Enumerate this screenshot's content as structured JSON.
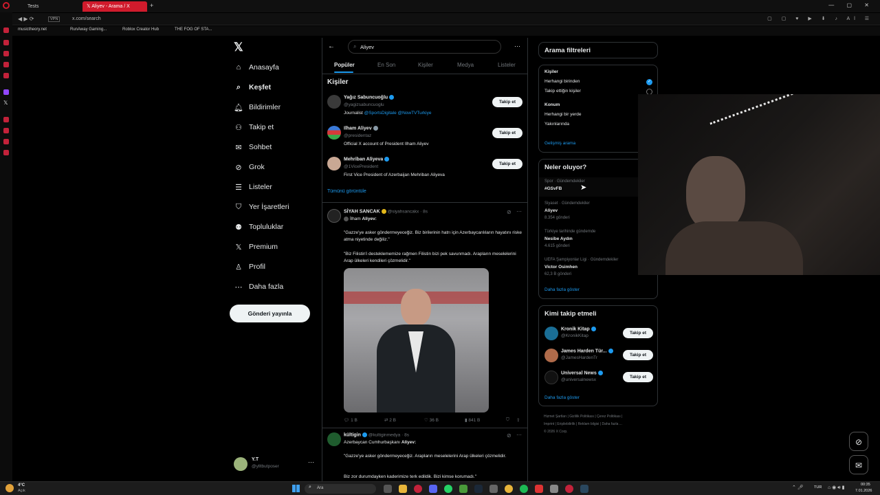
{
  "browser": {
    "tabs": [
      {
        "label": "Tests"
      },
      {
        "label": "Aliyev - Arama / X"
      }
    ],
    "url": "x.com/search",
    "vpn": "VPN",
    "bookmarks": [
      "musictheory.net",
      "RunAway Gaming...",
      "Roblox Creator Hub",
      "THE FOG OF STA..."
    ]
  },
  "sidebar": {
    "items": [
      {
        "label": "Anasayfa",
        "icon": "home-icon"
      },
      {
        "label": "Keşfet",
        "icon": "search-icon"
      },
      {
        "label": "Bildirimler",
        "icon": "bell-icon"
      },
      {
        "label": "Takip et",
        "icon": "add-user-icon"
      },
      {
        "label": "Sohbet",
        "icon": "mail-icon"
      },
      {
        "label": "Grok",
        "icon": "grok-icon"
      },
      {
        "label": "Listeler",
        "icon": "list-icon"
      },
      {
        "label": "Yer İşaretleri",
        "icon": "bookmark-icon"
      },
      {
        "label": "Topluluklar",
        "icon": "communities-icon"
      },
      {
        "label": "Premium",
        "icon": "x-icon"
      },
      {
        "label": "Profil",
        "icon": "profile-icon"
      },
      {
        "label": "Daha fazla",
        "icon": "more-icon"
      }
    ],
    "post_button": "Gönderi yayınla",
    "account": {
      "name": "Y.T",
      "handle": "@ylltbutposer"
    }
  },
  "search": {
    "query": "Aliyev",
    "tabs": [
      "Popüler",
      "En Son",
      "Kişiler",
      "Medya",
      "Listeler"
    ]
  },
  "people": {
    "title": "Kişiler",
    "show_all": "Tümünü görüntüle",
    "follow": "Takip et",
    "list": [
      {
        "name": "Yağız Sabuncuoğlu",
        "handle": "@yagizsabuncuoglu",
        "bio_pre": "Journalist ",
        "bio_links": "@SportsDigitale @NowTVTurkiye"
      },
      {
        "name": "Ilham Aliyev",
        "handle": "@presidentaz",
        "bio_pre": "Official X account of President Ilham Aliyev",
        "bio_links": ""
      },
      {
        "name": "Mehriban Aliyeva",
        "handle": "@1VicePresident",
        "bio_pre": "First Vice President of Azerbaijan Mehriban Aliyeva",
        "bio_links": ""
      }
    ]
  },
  "tweet1": {
    "name": "SİYAH SANCAK",
    "handle": "@siyahsancakx",
    "time": "· 8s",
    "ref_name": "İlham",
    "ref_word": "Aliyev:",
    "p1": "\"Gazze'ye asker göndermeyeceğiz. Biz birilerinin hatrı için Azerbaycanlıların hayatını riske atma niyetinde değiliz.\"",
    "p2": "\"Biz Filistin'i desteklememize rağmen Filistin bizi pek savunmadı. Arapların meselelerini Arap ülkeleri kendileri çözmelidir.\"",
    "replies": "1 B",
    "reposts": "2 B",
    "likes": "36 B",
    "views": "841 B"
  },
  "tweet2": {
    "name": "kültigin",
    "handle": "@kultiginmedya",
    "time": "· 8s",
    "line1_pre": "Azerbaycan Cumhurbaşkanı ",
    "line1_bold": "Aliyev:",
    "p1": "\"Gazze'ye asker göndermeyeceğiz. Arapların meselelerini Arap ülkeleri çözmelidir.",
    "p2": "Biz zor durumdayken kaderimize terk edildik. Bizi kimse korumadı.\""
  },
  "filters": {
    "title": "Arama filtreleri",
    "people_label": "Kişiler",
    "opt1": "Herhangi birinden",
    "opt2": "Takip ettiğin kişiler",
    "loc_label": "Konum",
    "opt3": "Herhangi bir yerde",
    "opt4": "Yakınlarında",
    "advanced": "Gelişmiş arama"
  },
  "trends": {
    "title": "Neler oluyor?",
    "more": "Daha fazla göster",
    "items": [
      {
        "ctx": "Spor · Gündemdekiler",
        "topic": "#GSvFB",
        "count": ""
      },
      {
        "ctx": "Siyaset · Gündemdekiler",
        "topic": "Aliyev",
        "count": "8.354 gönderi"
      },
      {
        "ctx": "Türkiye tarihinde gündemde",
        "topic": "Nesibe Aydın",
        "count": "4.615 gönderi"
      },
      {
        "ctx": "UEFA Şampiyonlar Ligi · Gündemdekiler",
        "topic": "Victor Osimhen",
        "count": "62,3 B gönderi"
      }
    ]
  },
  "whotofollow": {
    "title": "Kimi takip etmeli",
    "more": "Daha fazla göster",
    "follow": "Takip et",
    "items": [
      {
        "name": "Kronik Kitap",
        "handle": "@KronikKitap"
      },
      {
        "name": "James Harden Tür...",
        "handle": "@JamesHardenTr"
      },
      {
        "name": "Universal News",
        "handle": "@universalnewsx"
      }
    ]
  },
  "footer": [
    "Hizmet Şartları",
    "Gizlilik Politikası",
    "Çerez Politikası",
    "Imprint",
    "Erişilebilirlik",
    "Reklam bilgisi",
    "Daha fazla ...",
    "© 2026 X Corp."
  ],
  "taskbar": {
    "weather_temp": "4°C",
    "weather_desc": "Açık",
    "search": "Ara",
    "lang": "TUR",
    "time": "00:35",
    "date": "7.01.2026"
  }
}
